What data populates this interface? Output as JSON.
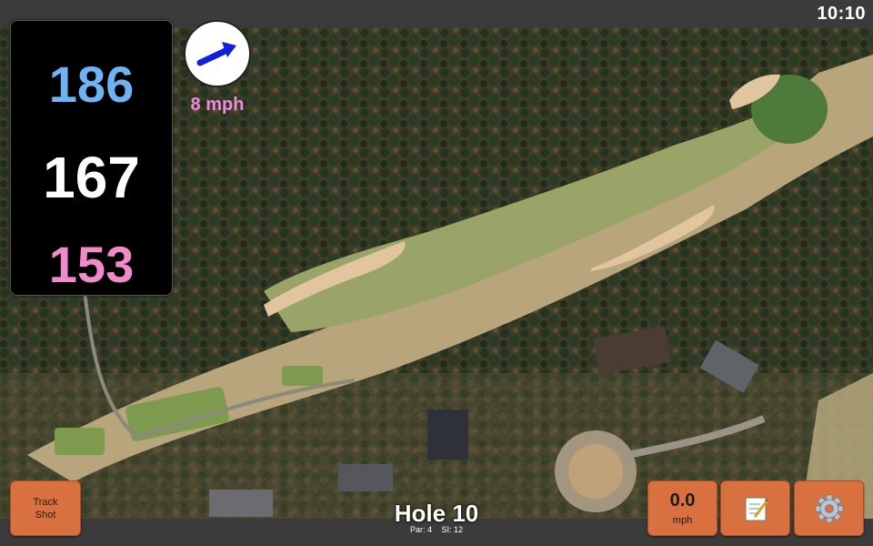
{
  "status": {
    "time": "10:10"
  },
  "yardages": {
    "back": "186",
    "middle": "167",
    "front": "153",
    "colors": {
      "back": "#6eb4f5",
      "middle": "#ffffff",
      "front": "#f08ac8"
    }
  },
  "wind": {
    "speed": "8 mph",
    "arrow_icon": "wind-arrow-icon",
    "speed_color": "#f08ae0"
  },
  "buttons": {
    "track_shot_line1": "Track",
    "track_shot_line2": "Shot",
    "speed_value": "0.0",
    "speed_unit": "mph",
    "notes_icon": "notepad-icon",
    "settings_icon": "gear-icon"
  },
  "hole": {
    "title": "Hole 10",
    "par": "Par: 4",
    "stroke_index": "SI: 12"
  },
  "colors": {
    "button": "#d9703f",
    "panel": "#000000",
    "bar": "#3b3b3b"
  }
}
